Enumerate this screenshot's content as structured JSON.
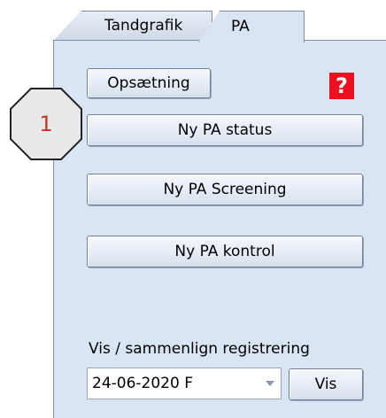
{
  "tabs": [
    {
      "label": "Tandgrafik",
      "active": false
    },
    {
      "label": "PA",
      "active": true
    }
  ],
  "buttons": {
    "setup": "Opsætning",
    "new_status": "Ny PA status",
    "new_screening": "Ny PA Screening",
    "new_control": "Ny PA kontrol",
    "show": "Vis"
  },
  "help": {
    "label": "?",
    "color": "#ee0f1f"
  },
  "registration": {
    "label": "Vis / sammenlign registrering",
    "selected": "24-06-2020  F"
  },
  "callout": {
    "label": "1"
  },
  "icons": {
    "dropdown": "chevron-down-icon",
    "help": "question-icon"
  },
  "colors": {
    "panel": "#dae5f4",
    "accent": "#ee0f1f"
  }
}
